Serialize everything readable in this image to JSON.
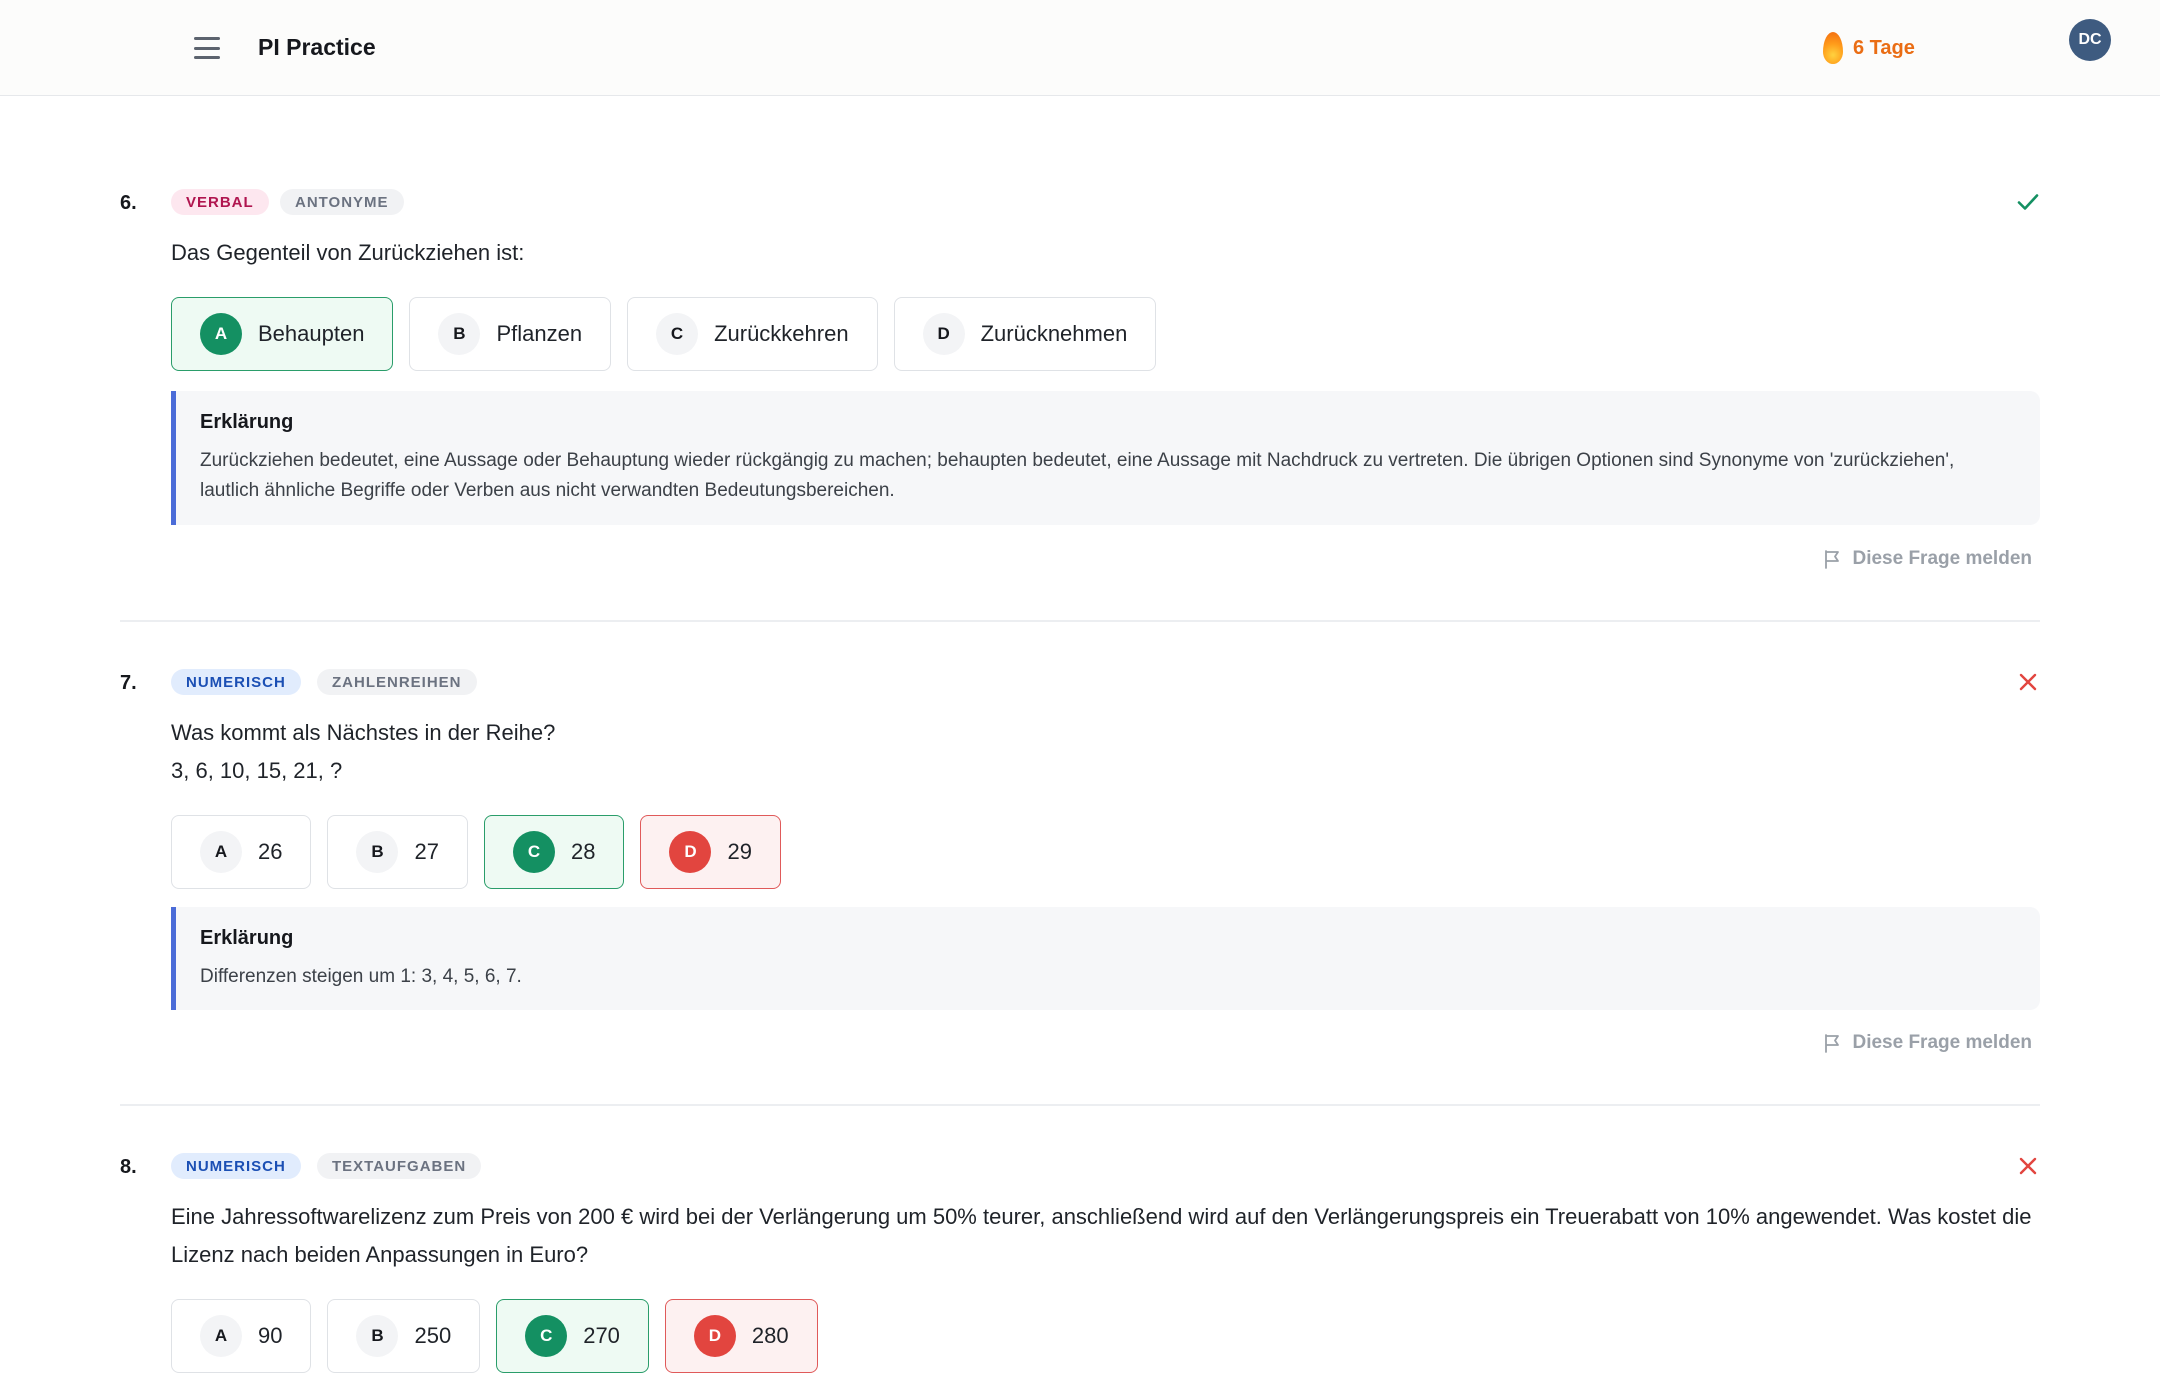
{
  "header": {
    "app_title": "PI Practice",
    "streak_label": "6 Tage",
    "avatar_initials": "DC"
  },
  "report_label": "Diese Frage melden",
  "explanation_title": "Erklärung",
  "questions": [
    {
      "number": "6.",
      "category": "VERBAL",
      "subcategory": "ANTONYME",
      "status": "correct",
      "text_lines": [
        "Das Gegenteil von Zurückziehen ist:"
      ],
      "options": [
        {
          "letter": "A",
          "label": "Behaupten",
          "state": "correct"
        },
        {
          "letter": "B",
          "label": "Pflanzen",
          "state": "default"
        },
        {
          "letter": "C",
          "label": "Zurückkehren",
          "state": "default"
        },
        {
          "letter": "D",
          "label": "Zurücknehmen",
          "state": "default"
        }
      ],
      "explanation": "Zurückziehen bedeutet, eine Aussage oder Behauptung wieder rückgängig zu machen; behaupten bedeutet, eine Aussage mit Nachdruck zu vertreten. Die übrigen Optionen sind Synonyme von 'zurückziehen', lautlich ähnliche Begriffe oder Verben aus nicht verwandten Bedeutungsbereichen."
    },
    {
      "number": "7.",
      "category": "NUMERISCH",
      "subcategory": "ZAHLENREIHEN",
      "status": "wrong",
      "text_lines": [
        "Was kommt als Nächstes in der Reihe?",
        "3, 6, 10, 15, 21, ?"
      ],
      "options": [
        {
          "letter": "A",
          "label": "26",
          "state": "default"
        },
        {
          "letter": "B",
          "label": "27",
          "state": "default"
        },
        {
          "letter": "C",
          "label": "28",
          "state": "correct"
        },
        {
          "letter": "D",
          "label": "29",
          "state": "wrong"
        }
      ],
      "explanation": "Differenzen steigen um 1: 3, 4, 5, 6, 7."
    },
    {
      "number": "8.",
      "category": "NUMERISCH",
      "subcategory": "TEXTAUFGABEN",
      "status": "wrong",
      "text_lines": [
        "Eine Jahressoftwarelizenz zum Preis von 200 € wird bei der Verlängerung um 50% teurer, anschließend wird auf den Verlängerungspreis ein Treuerabatt von 10% angewendet. Was kostet die Lizenz nach beiden Anpassungen in Euro?"
      ],
      "options": [
        {
          "letter": "A",
          "label": "90",
          "state": "default"
        },
        {
          "letter": "B",
          "label": "250",
          "state": "default"
        },
        {
          "letter": "C",
          "label": "270",
          "state": "correct"
        },
        {
          "letter": "D",
          "label": "280",
          "state": "wrong"
        }
      ]
    }
  ],
  "colors": {
    "correct": "#149062",
    "wrong": "#e2453f",
    "explanation_accent": "#4b6cd8",
    "streak": "#ea6d14"
  }
}
